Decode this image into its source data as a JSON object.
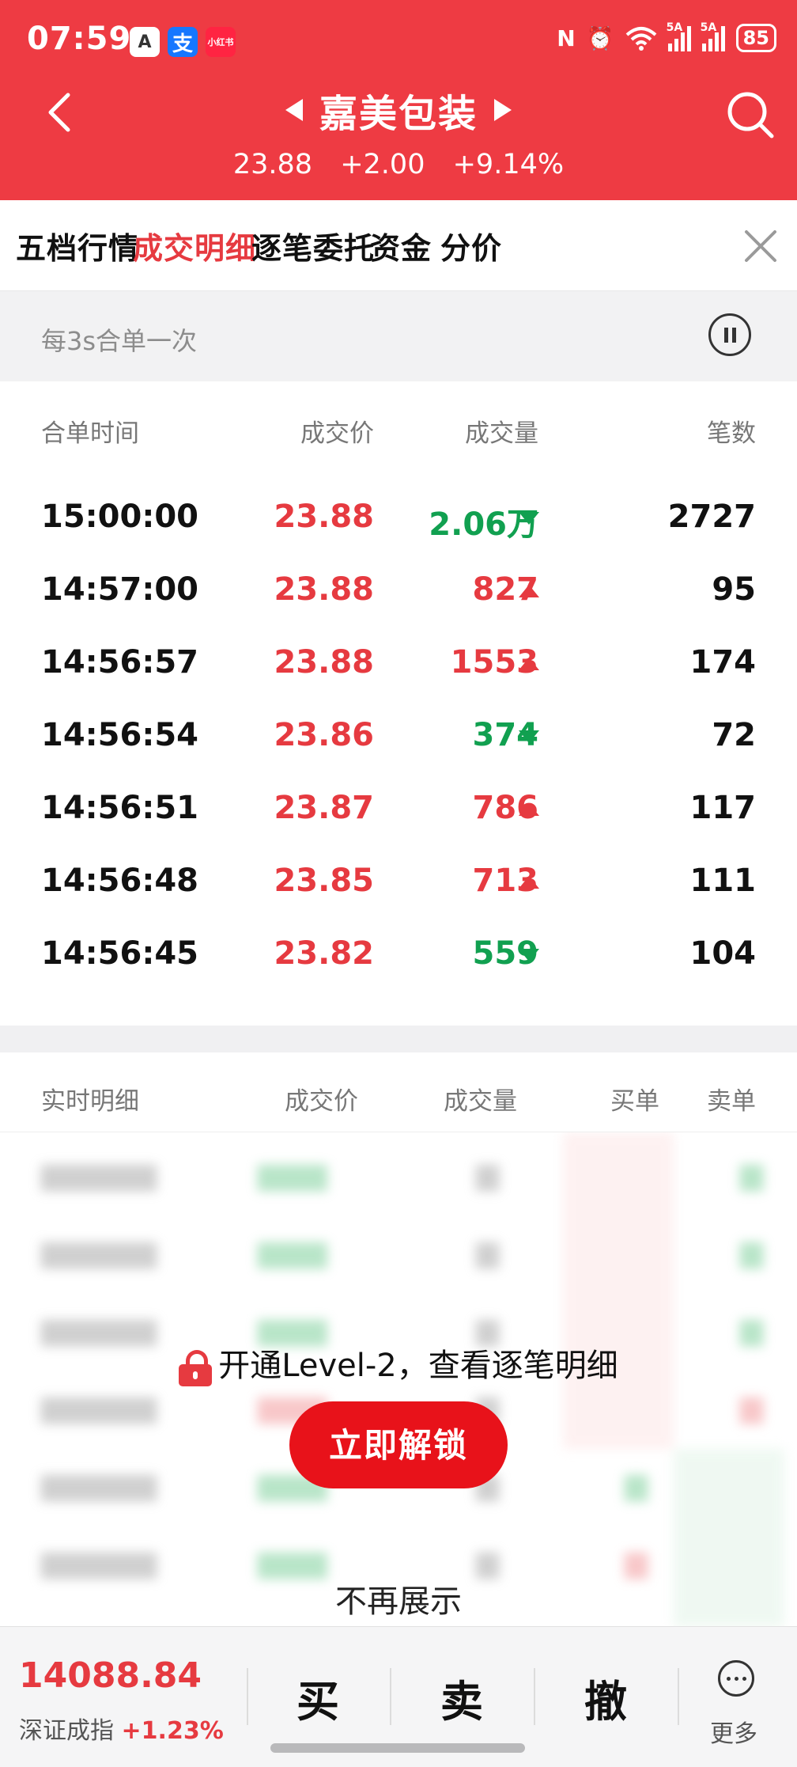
{
  "status": {
    "time": "07:59",
    "apps": [
      "A",
      "支",
      "小红书"
    ],
    "network": "5A",
    "battery": "85"
  },
  "header": {
    "stock_name": "嘉美包装",
    "price": "23.88",
    "change": "+2.00",
    "change_pct": "+9.14%"
  },
  "tabs": [
    "五档行情",
    "成交明细",
    "逐笔委托",
    "资金",
    "分价"
  ],
  "active_tab": "成交明细",
  "merge": {
    "text": "每3s合单一次"
  },
  "trades": {
    "headers": {
      "time": "合单时间",
      "price": "成交价",
      "volume": "成交量",
      "count": "笔数"
    },
    "rows": [
      {
        "time": "15:00:00",
        "price": "23.88",
        "volume": "2.06万",
        "dir": "down",
        "count": "2727"
      },
      {
        "time": "14:57:00",
        "price": "23.88",
        "volume": "827",
        "dir": "up",
        "count": "95"
      },
      {
        "time": "14:56:57",
        "price": "23.88",
        "volume": "1553",
        "dir": "up",
        "count": "174"
      },
      {
        "time": "14:56:54",
        "price": "23.86",
        "volume": "374",
        "dir": "down",
        "count": "72"
      },
      {
        "time": "14:56:51",
        "price": "23.87",
        "volume": "786",
        "dir": "up",
        "count": "117"
      },
      {
        "time": "14:56:48",
        "price": "23.85",
        "volume": "713",
        "dir": "up",
        "count": "111"
      },
      {
        "time": "14:56:45",
        "price": "23.82",
        "volume": "559",
        "dir": "down",
        "count": "104"
      }
    ]
  },
  "realtime": {
    "headers": {
      "title": "实时明细",
      "price": "成交价",
      "volume": "成交量",
      "buy": "买单",
      "sell": "卖单"
    },
    "lock_text": "开通Level-2，查看逐笔明细",
    "unlock_label": "立即解锁",
    "dismiss_label": "不再展示"
  },
  "bottom": {
    "index_value": "14088.84",
    "index_name": "深证成指",
    "index_pct": "+1.23%",
    "buy": "买",
    "sell": "卖",
    "cancel": "撤",
    "more": "更多"
  },
  "colors": {
    "header_bg": "#ee3b43",
    "up": "#e63a40",
    "down": "#11a050"
  }
}
